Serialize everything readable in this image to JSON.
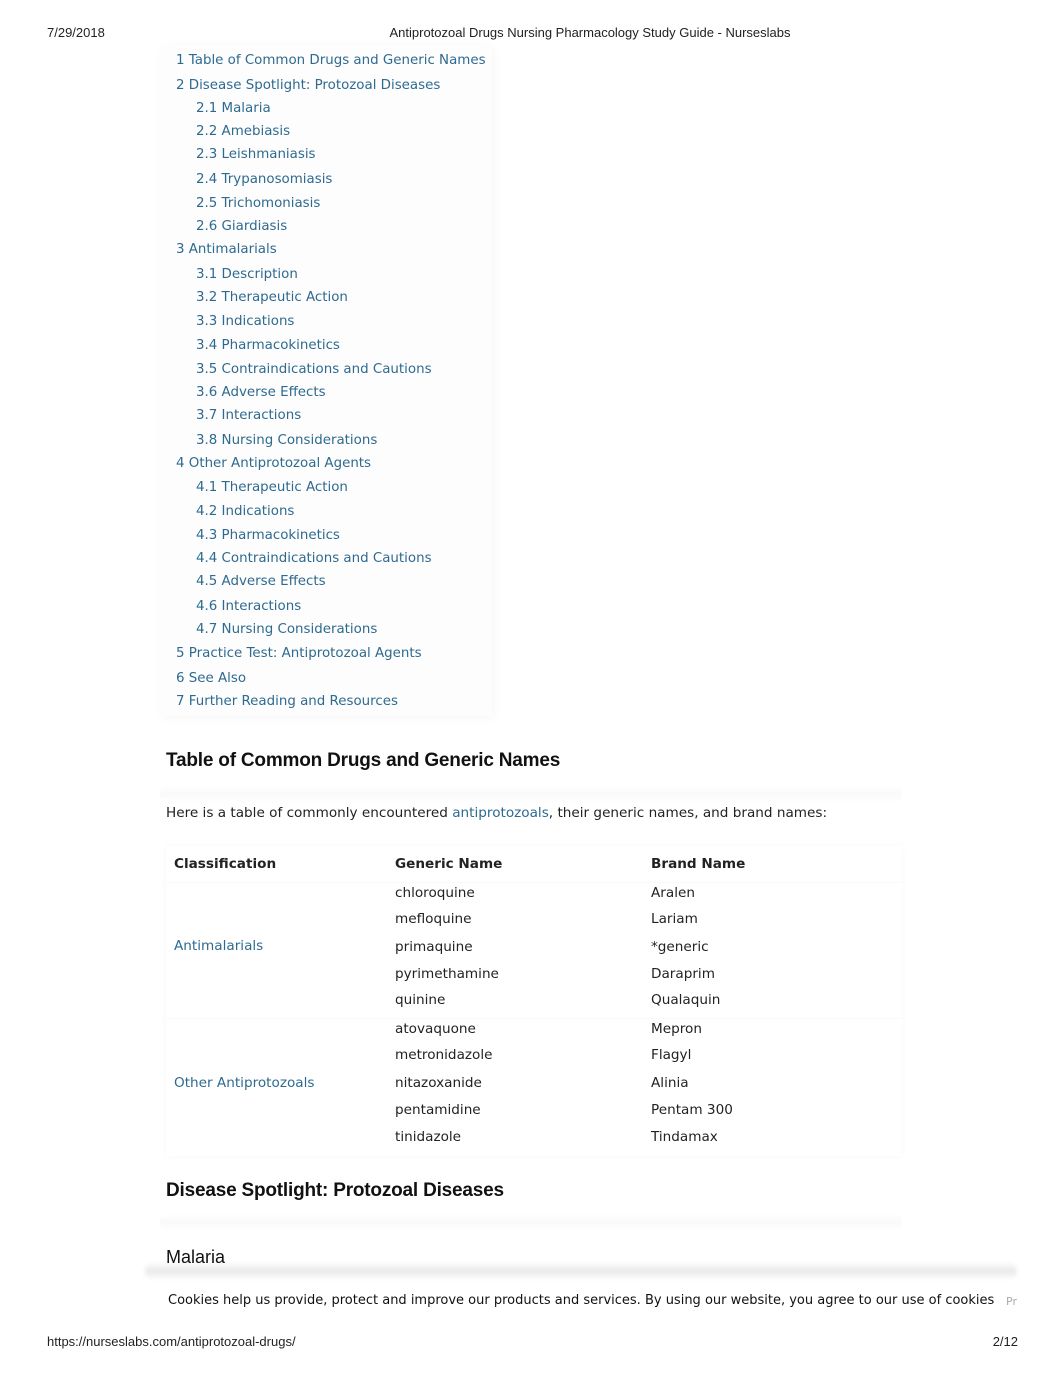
{
  "print_header": {
    "date": "7/29/2018",
    "title": "Antiprotozoal Drugs Nursing Pharmacology Study Guide - Nurseslabs"
  },
  "print_footer": {
    "url": "https://nurseslabs.com/antiprotozoal-drugs/",
    "page": "2/12"
  },
  "toc": {
    "items": [
      {
        "label": "1 Table of Common Drugs and Generic Names",
        "level": 1
      },
      {
        "label": "2 Disease Spotlight: Protozoal Diseases",
        "level": 1
      },
      {
        "label": "2.1 Malaria",
        "level": 2
      },
      {
        "label": "2.2 Amebiasis",
        "level": 2
      },
      {
        "label": "2.3 Leishmaniasis",
        "level": 2
      },
      {
        "label": "2.4 Trypanosomiasis",
        "level": 2
      },
      {
        "label": "2.5 Trichomoniasis",
        "level": 2
      },
      {
        "label": "2.6 Giardiasis",
        "level": 2
      },
      {
        "label": "3 Antimalarials",
        "level": 1
      },
      {
        "label": "3.1 Description",
        "level": 2
      },
      {
        "label": "3.2 Therapeutic Action",
        "level": 2
      },
      {
        "label": "3.3 Indications",
        "level": 2
      },
      {
        "label": "3.4 Pharmacokinetics",
        "level": 2
      },
      {
        "label": "3.5 Contraindications and Cautions",
        "level": 2
      },
      {
        "label": "3.6 Adverse Effects",
        "level": 2
      },
      {
        "label": "3.7 Interactions",
        "level": 2
      },
      {
        "label": "3.8 Nursing Considerations",
        "level": 2
      },
      {
        "label": "4 Other Antiprotozoal Agents",
        "level": 1
      },
      {
        "label": "4.1 Therapeutic Action",
        "level": 2
      },
      {
        "label": "4.2 Indications",
        "level": 2
      },
      {
        "label": "4.3 Pharmacokinetics",
        "level": 2
      },
      {
        "label": "4.4 Contraindications and Cautions",
        "level": 2
      },
      {
        "label": "4.5 Adverse Effects",
        "level": 2
      },
      {
        "label": "4.6 Interactions",
        "level": 2
      },
      {
        "label": "4.7 Nursing Considerations",
        "level": 2
      },
      {
        "label": "5 Practice Test: Antiprotozoal Agents",
        "level": 1
      },
      {
        "label": "6 See Also",
        "level": 1
      },
      {
        "label": "7 Further Reading and Resources",
        "level": 1
      }
    ]
  },
  "section_table": {
    "heading": "Table of Common Drugs and Generic Names",
    "intro_before": "Here is a table of commonly encountered ",
    "intro_link": "antiprotozoals",
    "intro_after": ", their generic names, and brand names:",
    "columns": [
      "Classification",
      "Generic Name",
      "Brand Name"
    ],
    "groups": [
      {
        "classification": "Antimalarials",
        "rows": [
          {
            "generic": "chloroquine",
            "brand": "Aralen"
          },
          {
            "generic": "mefloquine",
            "brand": "Lariam"
          },
          {
            "generic": "primaquine",
            "brand": "*generic"
          },
          {
            "generic": "pyrimethamine",
            "brand": "Daraprim"
          },
          {
            "generic": "quinine",
            "brand": "Qualaquin"
          }
        ]
      },
      {
        "classification": "Other Antiprotozoals",
        "rows": [
          {
            "generic": "atovaquone",
            "brand": "Mepron"
          },
          {
            "generic": "metronidazole",
            "brand": "Flagyl"
          },
          {
            "generic": "nitazoxanide",
            "brand": "Alinia"
          },
          {
            "generic": "pentamidine",
            "brand": "Pentam 300"
          },
          {
            "generic": "tinidazole",
            "brand": "Tindamax"
          }
        ]
      }
    ]
  },
  "section_disease": {
    "heading": "Disease Spotlight: Protozoal Diseases",
    "subheading": "Malaria"
  },
  "cookie_bar": {
    "text": "Cookies help us provide, protect and improve our products and services. By using our website, you agree to our use of cookies",
    "more_link": "Pr"
  },
  "colors": {
    "link": "#2e6a8f",
    "text": "#222222"
  }
}
